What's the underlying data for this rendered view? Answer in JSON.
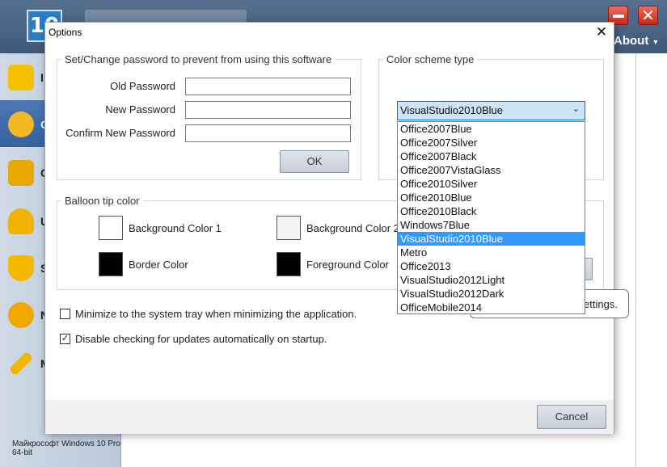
{
  "app": {
    "logo": "10",
    "about_label": "About",
    "status": "Майкрософт Windows 10 Pro 64-bit",
    "sidebar_items": [
      {
        "label": "I",
        "icon": "info-icon",
        "color": "#f5c000"
      },
      {
        "label": "O",
        "icon": "gauge-icon",
        "color": "#f2b823"
      },
      {
        "label": "C",
        "icon": "trash-icon",
        "color": "#e8a900"
      },
      {
        "label": "U",
        "icon": "user-icon",
        "color": "#f0b400"
      },
      {
        "label": "S",
        "icon": "shield-icon",
        "color": "#f5b800"
      },
      {
        "label": "N",
        "icon": "globe-icon",
        "color": "#f0a800"
      },
      {
        "label": "M",
        "icon": "wrench-icon",
        "color": "#f2b500"
      }
    ]
  },
  "dialog": {
    "title": "Options",
    "close_glyph": "✕",
    "password_group": {
      "legend": "Set/Change password to prevent from using this software",
      "old_password_label": "Old Password",
      "new_password_label": "New Password",
      "confirm_password_label": "Confirm New Password",
      "old_password_value": "",
      "new_password_value": "",
      "confirm_password_value": "",
      "ok_label": "OK"
    },
    "color_scheme_group": {
      "legend": "Color scheme type",
      "selected": "VisualStudio2010Blue",
      "options": [
        "Office2007Blue",
        "Office2007Silver",
        "Office2007Black",
        "Office2007VistaGlass",
        "Office2010Silver",
        "Office2010Blue",
        "Office2010Black",
        "Windows7Blue",
        "VisualStudio2010Blue",
        "Metro",
        "Office2013",
        "VisualStudio2012Light",
        "VisualStudio2012Dark",
        "OfficeMobile2014"
      ]
    },
    "balloon_group": {
      "legend": "Balloon tip color",
      "background_color_1_label": "Background Color 1",
      "background_color_2_label": "Background Color 2",
      "border_color_label": "Border Color",
      "foreground_color_label": "Foreground Color",
      "background_color_1": "#ffffff",
      "background_color_2": "#f4f4f4",
      "border_color": "#000000",
      "foreground_color": "#000000"
    },
    "tooltip_visible_text": "ettings.",
    "minimize_to_tray": {
      "label": "Minimize to the system tray when minimizing the application.",
      "checked": false
    },
    "disable_update_check": {
      "label": "Disable checking for updates automatically on startup.",
      "checked": true
    },
    "cancel_label": "Cancel"
  }
}
